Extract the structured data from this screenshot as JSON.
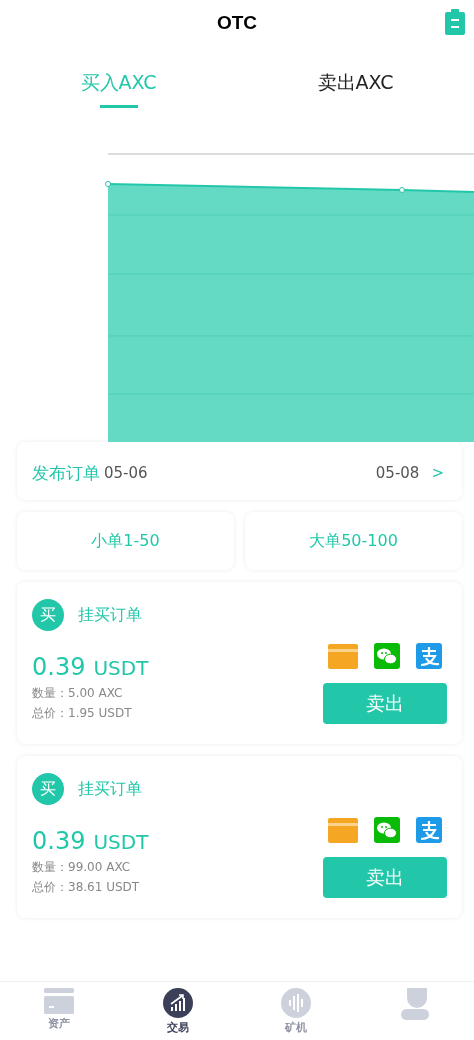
{
  "header": {
    "title": "OTC"
  },
  "tabs": [
    {
      "label": "买入AXC",
      "selected": true
    },
    {
      "label": "卖出AXC",
      "selected": false
    }
  ],
  "chart": {
    "x_labels": [
      "05-06",
      "05-08"
    ]
  },
  "publish": {
    "label": "发布订单",
    "arrow": ">"
  },
  "filters": [
    {
      "label": "小单1-50"
    },
    {
      "label": "大单50-100"
    }
  ],
  "orders": [
    {
      "badge": "买",
      "title": "挂买订单",
      "price": "0.39",
      "unit": "USDT",
      "quantity": "数量：5.00 AXC",
      "total": "总价：1.95 USDT",
      "button": "卖出"
    },
    {
      "badge": "买",
      "title": "挂买订单",
      "price": "0.39",
      "unit": "USDT",
      "quantity": "数量：99.00 AXC",
      "total": "总价：38.61 USDT",
      "button": "卖出"
    }
  ],
  "nav": [
    {
      "kind": "wallet",
      "label": "资产",
      "selected": false
    },
    {
      "kind": "trade",
      "label": "交易",
      "selected": true
    },
    {
      "kind": "mining",
      "label": "矿机",
      "selected": false
    },
    {
      "kind": "user",
      "selected": false
    }
  ]
}
